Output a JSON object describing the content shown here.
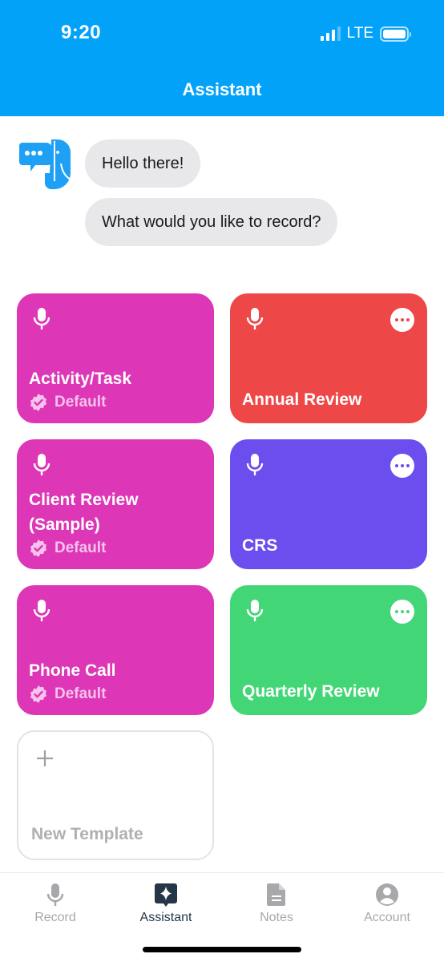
{
  "status_bar": {
    "time": "9:20",
    "network": "LTE",
    "signal_bars_active": 3,
    "signal_bars_total": 4,
    "battery_level": 1.0
  },
  "header": {
    "title": "Assistant",
    "background_color": "#03A2F9"
  },
  "chat": {
    "avatar_icon": "elephant-chat-logo-icon",
    "messages": [
      {
        "text": "Hello there!"
      },
      {
        "text": "What would you like to record?"
      }
    ]
  },
  "templates": [
    {
      "name": "Activity/Task",
      "color": "#DD36B6",
      "default": true,
      "badge_label": "Default",
      "has_more_menu": false
    },
    {
      "name": "Annual Review",
      "color": "#EE4747",
      "default": false,
      "has_more_menu": true
    },
    {
      "name": "Client Review (Sample)",
      "color": "#DD36B6",
      "default": true,
      "badge_label": "Default",
      "has_more_menu": false
    },
    {
      "name": "CRS",
      "color": "#6C4DEE",
      "default": false,
      "has_more_menu": true
    },
    {
      "name": "Phone Call",
      "color": "#DD36B6",
      "default": true,
      "badge_label": "Default",
      "has_more_menu": false
    },
    {
      "name": "Quarterly Review",
      "color": "#43D677",
      "default": false,
      "has_more_menu": true
    }
  ],
  "new_template": {
    "label": "New Template",
    "icon": "plus-icon"
  },
  "tabbar": {
    "items": [
      {
        "label": "Record",
        "icon": "microphone-icon",
        "active": false
      },
      {
        "label": "Assistant",
        "icon": "sparkle-chat-icon",
        "active": true
      },
      {
        "label": "Notes",
        "icon": "document-icon",
        "active": false
      },
      {
        "label": "Account",
        "icon": "account-icon",
        "active": false
      }
    ],
    "active_color": "#253746",
    "inactive_color": "#A8A8AC"
  }
}
